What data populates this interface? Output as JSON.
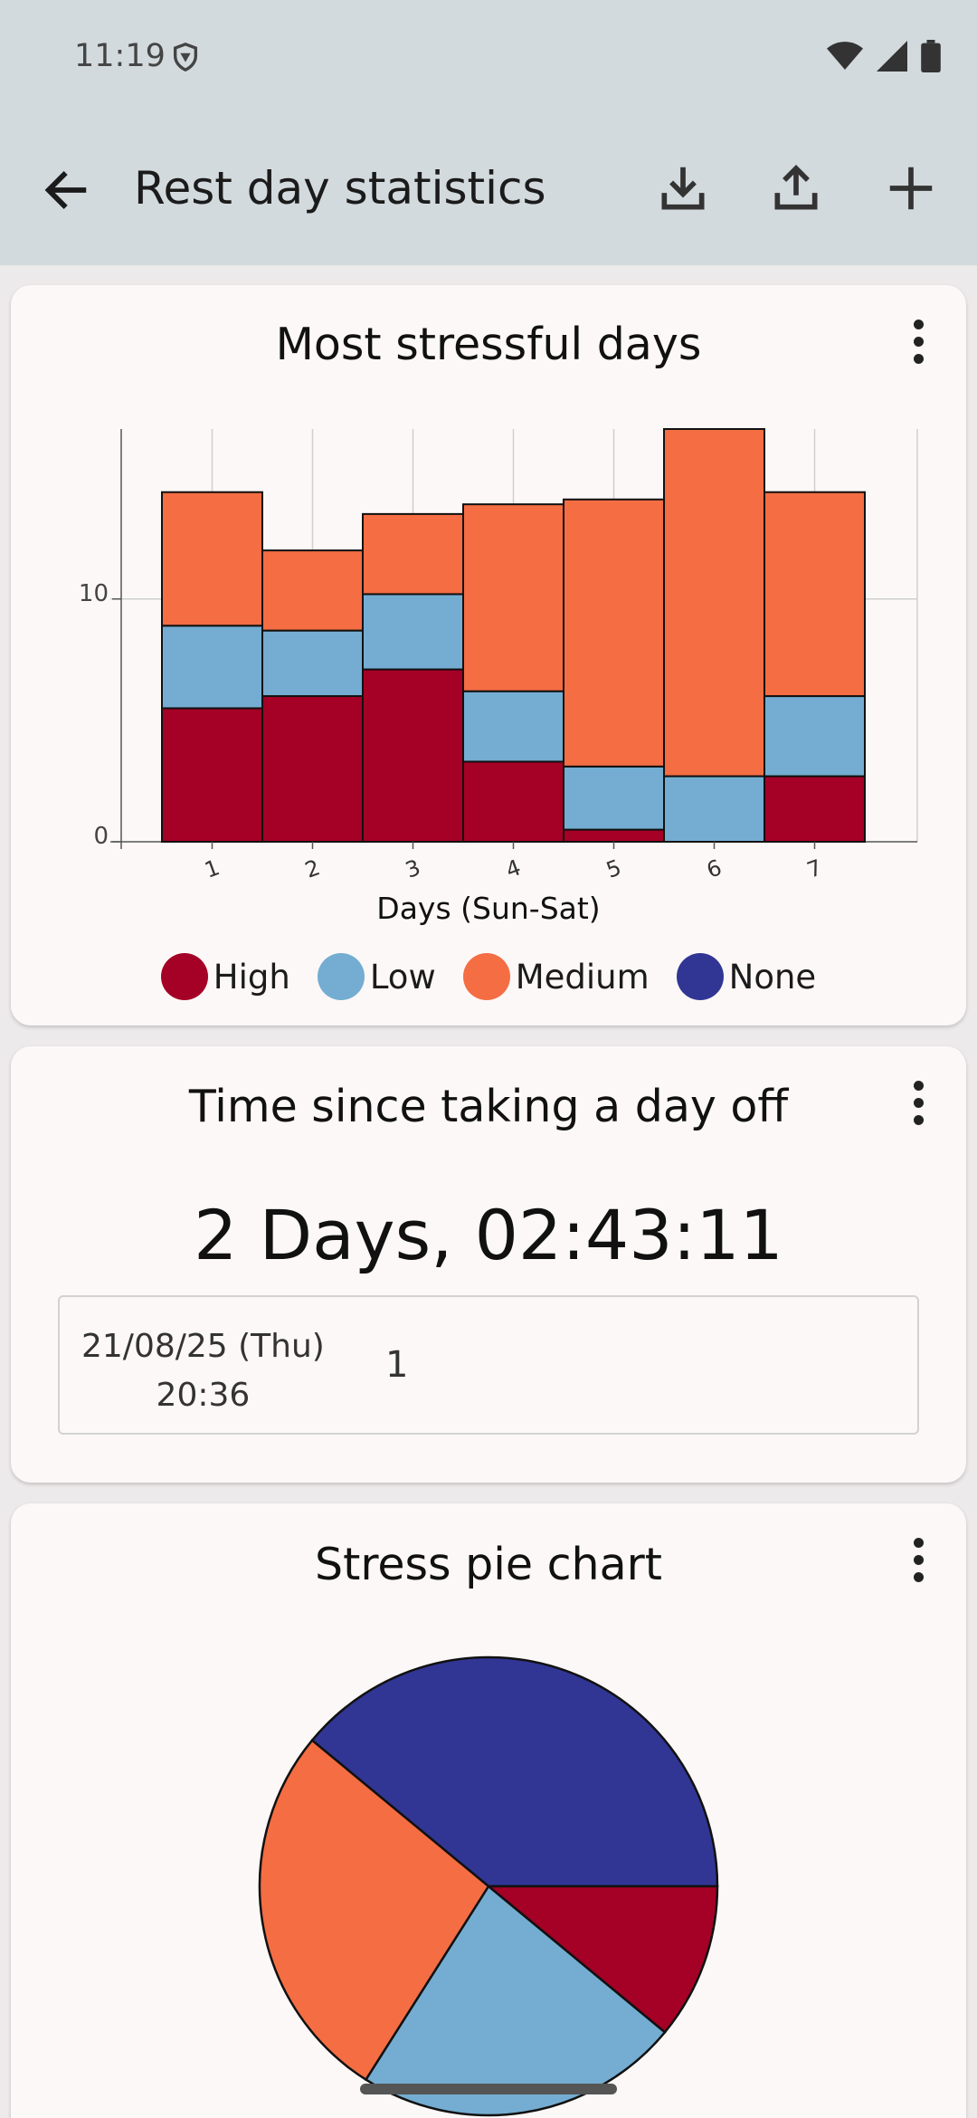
{
  "status_bar": {
    "time": "11:19",
    "icons": [
      "shield-icon",
      "wifi-icon",
      "signal-icon",
      "battery-icon"
    ]
  },
  "app_bar": {
    "title": "Rest day statistics",
    "actions": [
      "download-icon",
      "share-icon",
      "add-icon"
    ]
  },
  "colors": {
    "high": "#a50026",
    "low": "#74add1",
    "medium": "#f46d43",
    "none": "#313695"
  },
  "cards": {
    "stressful_days": {
      "title": "Most stressful days"
    },
    "time_since": {
      "title": "Time since taking a day off",
      "timer": "2 Days, 02:43:11",
      "entry": {
        "date": "21/08/25 (Thu)",
        "time": "20:36",
        "value": "1"
      }
    },
    "pie": {
      "title": "Stress pie chart"
    }
  },
  "chart_data": [
    {
      "type": "bar",
      "stacked": true,
      "title": "Most stressful days",
      "xlabel": "Days (Sun-Sat)",
      "ylabel": "",
      "categories": [
        "1",
        "2",
        "3",
        "4",
        "5",
        "6",
        "7"
      ],
      "yticks": [
        "0",
        "10"
      ],
      "ylim": [
        0,
        17
      ],
      "grid": true,
      "legend": "bottom",
      "series": [
        {
          "name": "High",
          "color": "#a50026",
          "values": [
            5.5,
            6,
            7.1,
            3.3,
            0.5,
            0,
            2.7
          ]
        },
        {
          "name": "Low",
          "color": "#74add1",
          "values": [
            3.4,
            2.7,
            3.1,
            2.9,
            2.6,
            2.7,
            3.3
          ]
        },
        {
          "name": "Medium",
          "color": "#f46d43",
          "values": [
            5.5,
            3.3,
            3.3,
            7.7,
            11,
            14.3,
            8.4
          ]
        },
        {
          "name": "None",
          "color": "#313695",
          "values": [
            0,
            0,
            0,
            0,
            0,
            0,
            0
          ]
        }
      ]
    },
    {
      "type": "pie",
      "title": "Stress pie chart",
      "slices": [
        {
          "name": "None",
          "value": 39,
          "color": "#313695"
        },
        {
          "name": "High",
          "value": 11,
          "color": "#a50026"
        },
        {
          "name": "Low",
          "value": 23,
          "color": "#74add1"
        },
        {
          "name": "Medium",
          "value": 27,
          "color": "#f46d43"
        }
      ]
    }
  ]
}
